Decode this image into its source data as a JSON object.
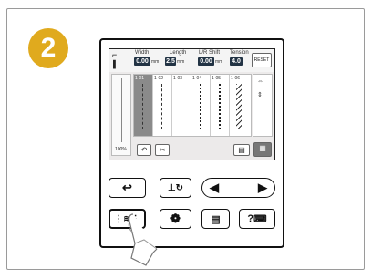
{
  "step": {
    "number": "2"
  },
  "colors": {
    "badge": "#e0aa1e",
    "frame": "#9a9a9a",
    "selected_cell": "#8a8a8a"
  },
  "screen": {
    "labels": {
      "width": "Width",
      "length": "Length",
      "lr_shift": "L/R Shift",
      "tension": "Tension"
    },
    "values": {
      "width": "0.00",
      "length": "2.5",
      "lr_shift": "0.00",
      "tension": "4.0"
    },
    "units": {
      "width": "mm",
      "length": "mm",
      "lr_shift": "mm"
    },
    "reset_label": "RESET",
    "zoom": "100%",
    "stitches": [
      {
        "code": "1-01",
        "selected": true
      },
      {
        "code": "1-02",
        "selected": false
      },
      {
        "code": "1-03",
        "selected": false
      },
      {
        "code": "1-04",
        "selected": false
      },
      {
        "code": "1-05",
        "selected": false
      },
      {
        "code": "1-06",
        "selected": false
      }
    ]
  },
  "buttons": {
    "back_icon": "back-arrow-icon",
    "needle_mode_icon": "needle-mode-icon",
    "prev_icon": "triangle-left-icon",
    "next_icon": "triangle-right-icon",
    "utility_icon": "utility-stitch-icon",
    "embroidery_icon": "embroidery-icon",
    "pattern_icon": "pattern-list-icon",
    "help_icon": "help-machine-icon",
    "help_label": "?"
  }
}
